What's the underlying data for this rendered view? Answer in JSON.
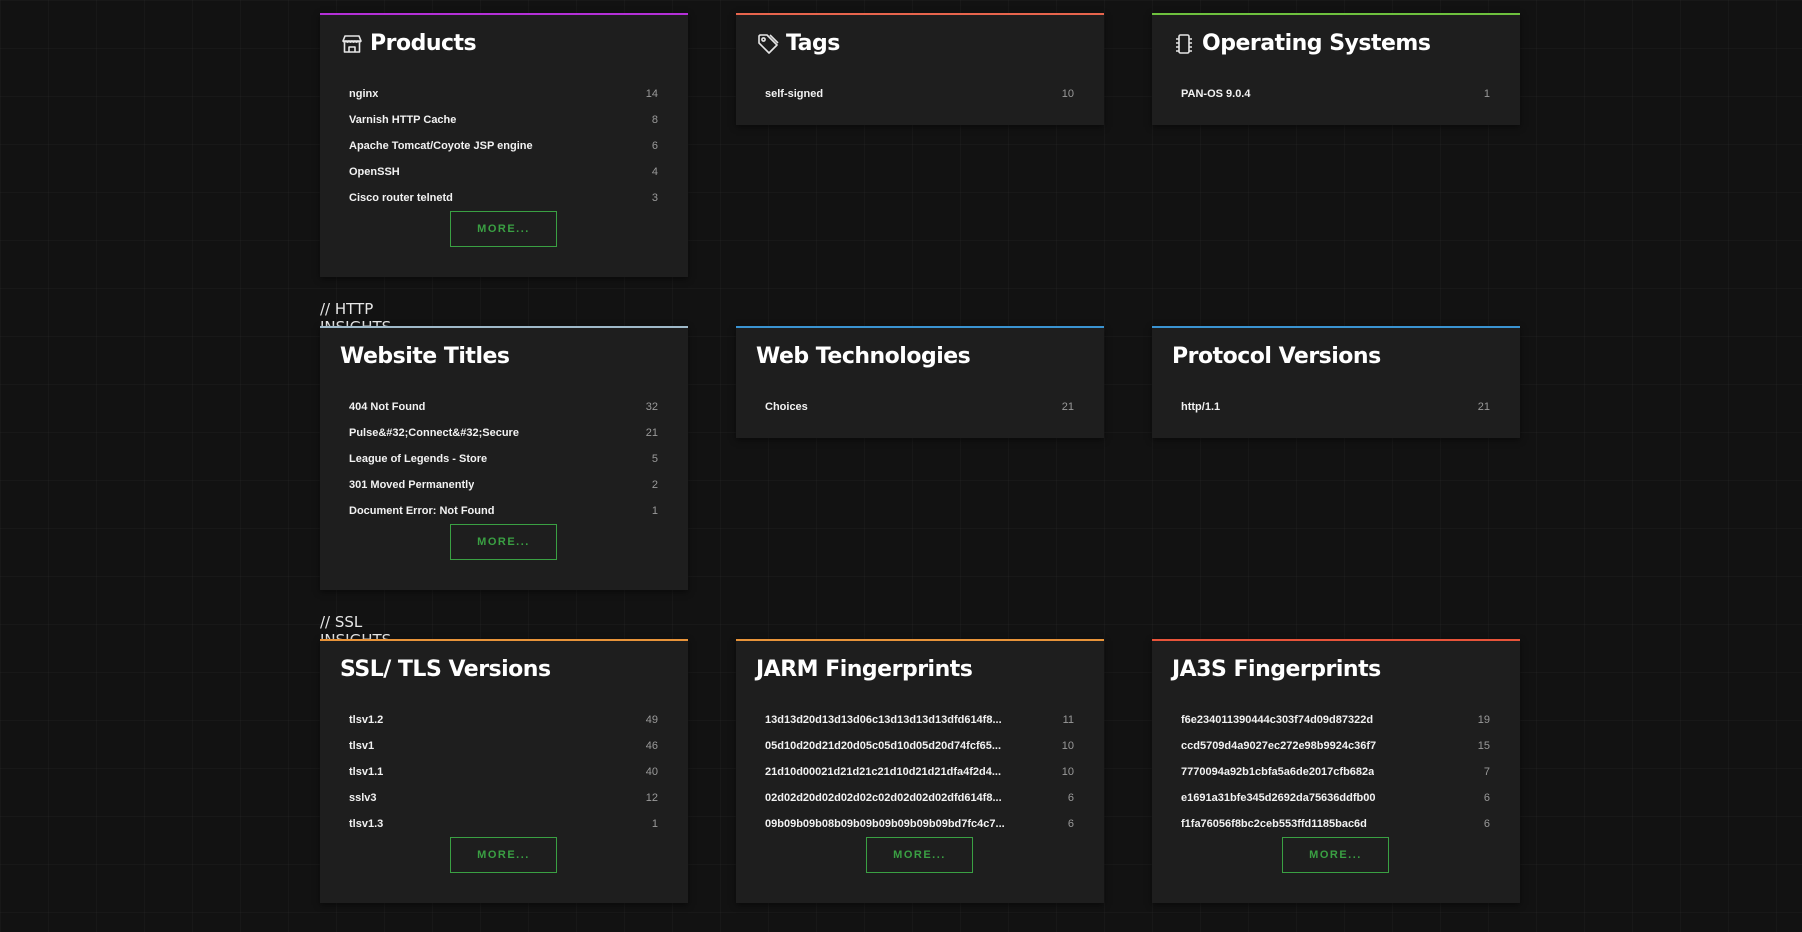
{
  "colors": {
    "products": "#b430d8",
    "tags": "#e8654d",
    "os": "#6ec13e",
    "website_titles": "#9fb9c9",
    "web_tech": "#3a93d1",
    "protocol": "#3a93d1",
    "ssl_versions": "#e8943a",
    "jarm": "#e8943a",
    "ja3s": "#e8543a",
    "more_button": "#3aa043"
  },
  "more_label": "MORE...",
  "sections": {
    "http": "// HTTP INSIGHTS",
    "ssl": "// SSL INSIGHTS"
  },
  "products": {
    "title": "Products",
    "icon": "store-icon",
    "items": [
      {
        "name": "nginx",
        "count": "14"
      },
      {
        "name": "Varnish HTTP Cache",
        "count": "8"
      },
      {
        "name": "Apache Tomcat/Coyote JSP engine",
        "count": "6"
      },
      {
        "name": "OpenSSH",
        "count": "4"
      },
      {
        "name": "Cisco router telnetd",
        "count": "3"
      }
    ]
  },
  "tags": {
    "title": "Tags",
    "icon": "tag-icon",
    "items": [
      {
        "name": "self-signed",
        "count": "10"
      }
    ]
  },
  "os": {
    "title": "Operating Systems",
    "icon": "chip-icon",
    "items": [
      {
        "name": "PAN-OS 9.0.4",
        "count": "1"
      }
    ]
  },
  "website_titles": {
    "title": "Website Titles",
    "items": [
      {
        "name": "404 Not Found",
        "count": "32"
      },
      {
        "name": "Pulse&#32;Connect&#32;Secure",
        "count": "21"
      },
      {
        "name": "League of Legends - Store",
        "count": "5"
      },
      {
        "name": "301 Moved Permanently",
        "count": "2"
      },
      {
        "name": "Document Error: Not Found",
        "count": "1"
      }
    ]
  },
  "web_tech": {
    "title": "Web Technologies",
    "items": [
      {
        "name": "Choices",
        "count": "21"
      }
    ]
  },
  "protocol": {
    "title": "Protocol Versions",
    "items": [
      {
        "name": "http/1.1",
        "count": "21"
      }
    ]
  },
  "ssl_versions": {
    "title": "SSL/ TLS Versions",
    "items": [
      {
        "name": "tlsv1.2",
        "count": "49"
      },
      {
        "name": "tlsv1",
        "count": "46"
      },
      {
        "name": "tlsv1.1",
        "count": "40"
      },
      {
        "name": "sslv3",
        "count": "12"
      },
      {
        "name": "tlsv1.3",
        "count": "1"
      }
    ]
  },
  "jarm": {
    "title": "JARM Fingerprints",
    "items": [
      {
        "name": "13d13d20d13d13d06c13d13d13d13dfd614f8...",
        "count": "11"
      },
      {
        "name": "05d10d20d21d20d05c05d10d05d20d74fcf65...",
        "count": "10"
      },
      {
        "name": "21d10d00021d21d21c21d10d21d21dfa4f2d4...",
        "count": "10"
      },
      {
        "name": "02d02d20d02d02d02c02d02d02d02dfd614f8...",
        "count": "6"
      },
      {
        "name": "09b09b09b08b09b09b09b09b09b09bd7fc4c7...",
        "count": "6"
      }
    ]
  },
  "ja3s": {
    "title": "JA3S Fingerprints",
    "items": [
      {
        "name": "f6e234011390444c303f74d09d87322d",
        "count": "19"
      },
      {
        "name": "ccd5709d4a9027ec272e98b9924c36f7",
        "count": "15"
      },
      {
        "name": "7770094a92b1cbfa5a6de2017cfb682a",
        "count": "7"
      },
      {
        "name": "e1691a31bfe345d2692da75636ddfb00",
        "count": "6"
      },
      {
        "name": "f1fa76056f8bc2ceb553ffd1185bac6d",
        "count": "6"
      }
    ]
  }
}
